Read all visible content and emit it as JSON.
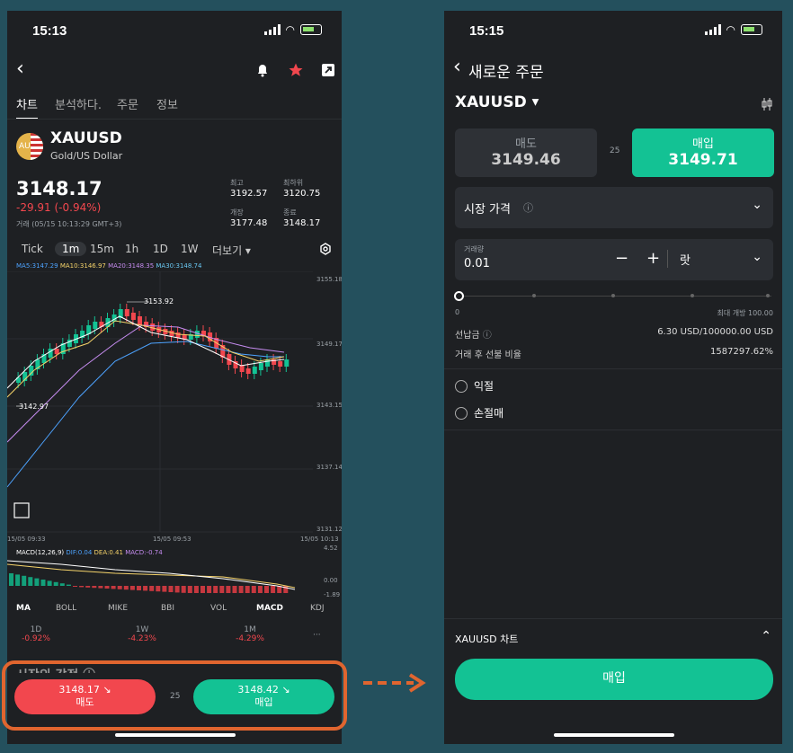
{
  "left": {
    "status_time": "15:13",
    "tabs": [
      "차트",
      "분석하다.",
      "주문",
      "정보"
    ],
    "symbol": "XAUUSD",
    "symbol_badge": "AU",
    "symbol_name": "Gold/US Dollar",
    "price": "3148.17",
    "change": "-29.91 (-0.94%)",
    "trade_time": "거래 (05/15 10:13:29 GMT+3)",
    "stats": {
      "high_label": "최고",
      "high": "3192.57",
      "low_label": "최하위",
      "low": "3120.75",
      "open_label": "개장",
      "open": "3177.48",
      "close_label": "종료",
      "close": "3148.17"
    },
    "timeframes": [
      "Tick",
      "1m",
      "15m",
      "1h",
      "1D",
      "1W",
      "더보기 ▾"
    ],
    "ma_line": {
      "ma5": "MA5:3147.29",
      "ma10": "MA10:3146.97",
      "ma20": "MA20:3148.35",
      "ma30": "MA30:3148.74"
    },
    "chart_labels": {
      "y_ticks": [
        "3155.18",
        "3149.17",
        "3143.15",
        "3137.14",
        "3131.12"
      ],
      "x_ticks": [
        "15/05 09:33",
        "15/05 09:53",
        "15/05 10:13"
      ],
      "max_marker": "3153.92",
      "min_marker": "3142.97"
    },
    "macd_line": {
      "label": "MACD(12,26,9)",
      "dif": "DIF:0.04",
      "dea": "DEA:0.41",
      "macd": "MACD:-0.74",
      "y_top": "4.52",
      "y_mid": "0.00",
      "y_bot": "-1.89"
    },
    "indicators": [
      "MA",
      "BOLL",
      "MIKE",
      "BBI",
      "VOL",
      "MACD",
      "KDJ"
    ],
    "perf": [
      {
        "period": "1D",
        "value": "-0.92%"
      },
      {
        "period": "1W",
        "value": "-4.23%"
      },
      {
        "period": "1M",
        "value": "-4.29%"
      }
    ],
    "more": "···",
    "partial_heading": "시장의 감정 ⓘ",
    "sell_price": "3148.17 ↘",
    "sell_label": "매도",
    "spread": "25",
    "buy_price": "3148.42 ↘",
    "buy_label": "매입"
  },
  "right": {
    "status_time": "15:15",
    "title": "새로운 주문",
    "symbol": "XAUUSD",
    "sell_label": "매도",
    "sell_price": "3149.46",
    "spread": "25",
    "buy_label": "매입",
    "buy_price": "3149.71",
    "order_type": "시장 가격",
    "volume_label": "거래량",
    "volume_value": "0.01",
    "unit": "랏",
    "slider_min": "0",
    "slider_max": "최대 개방 100.00",
    "margin_label": "선납금",
    "margin_value": "6.30 USD/100000.00 USD",
    "ratio_label": "거래 후 선불 비율",
    "ratio_value": "1587297.62%",
    "take_profit": "익절",
    "stop_loss": "손절매",
    "chart_toggle": "XAUUSD 차트",
    "submit": "매입"
  },
  "colors": {
    "background": "#24505d",
    "panel": "#1e2023",
    "green": "#13c294",
    "red": "#f2474e",
    "highlight": "#e0652f"
  }
}
